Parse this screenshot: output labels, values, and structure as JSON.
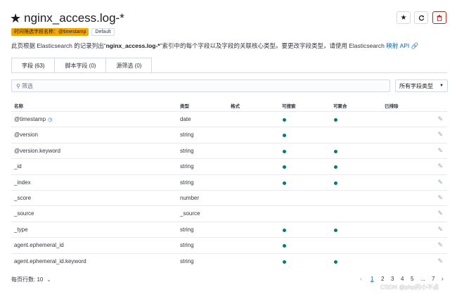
{
  "header": {
    "title": "nginx_access.log-*",
    "badge_time_field": "时间筛选字段名称：@timestamp",
    "badge_default": "Default"
  },
  "description": {
    "prefix": "此页根据 Elasticsearch 的记录列出“",
    "index": "nginx_access.log-*",
    "middle": "”索引中的每个字段以及字段的关联核心类型。要更改字段类型，请使用 Elasticsearch ",
    "link": "映射 API"
  },
  "tabs": [
    {
      "label": "字段 (63)"
    },
    {
      "label": "脚本字段 (0)"
    },
    {
      "label": "源筛选 (0)"
    }
  ],
  "search": {
    "placeholder": "筛选"
  },
  "type_select": {
    "value": "所有字段类型"
  },
  "columns": {
    "name": "名称",
    "type": "类型",
    "format": "格式",
    "searchable": "可搜索",
    "aggregatable": "可聚合",
    "excluded": "已排除"
  },
  "rows": [
    {
      "name": "@timestamp",
      "type": "date",
      "searchable": true,
      "aggregatable": true,
      "time": true
    },
    {
      "name": "@version",
      "type": "string",
      "searchable": true,
      "aggregatable": false
    },
    {
      "name": "@version.keyword",
      "type": "string",
      "searchable": true,
      "aggregatable": true
    },
    {
      "name": "_id",
      "type": "string",
      "searchable": true,
      "aggregatable": true
    },
    {
      "name": "_index",
      "type": "string",
      "searchable": true,
      "aggregatable": true
    },
    {
      "name": "_score",
      "type": "number",
      "searchable": false,
      "aggregatable": false
    },
    {
      "name": "_source",
      "type": "_source",
      "searchable": false,
      "aggregatable": false
    },
    {
      "name": "_type",
      "type": "string",
      "searchable": true,
      "aggregatable": true
    },
    {
      "name": "agent.ephemeral_id",
      "type": "string",
      "searchable": true,
      "aggregatable": false
    },
    {
      "name": "agent.ephemeral_id.keyword",
      "type": "string",
      "searchable": true,
      "aggregatable": true
    }
  ],
  "footer": {
    "rows_per_page": "每页行数: 10",
    "pages": [
      "1",
      "2",
      "3",
      "4",
      "5",
      "...",
      "7"
    ]
  },
  "watermark": "CSDN @php的小不点",
  "colors": {
    "accent": "#006bb4",
    "dot": "#017d73",
    "danger": "#bd271e",
    "badge": "#f5a700"
  }
}
